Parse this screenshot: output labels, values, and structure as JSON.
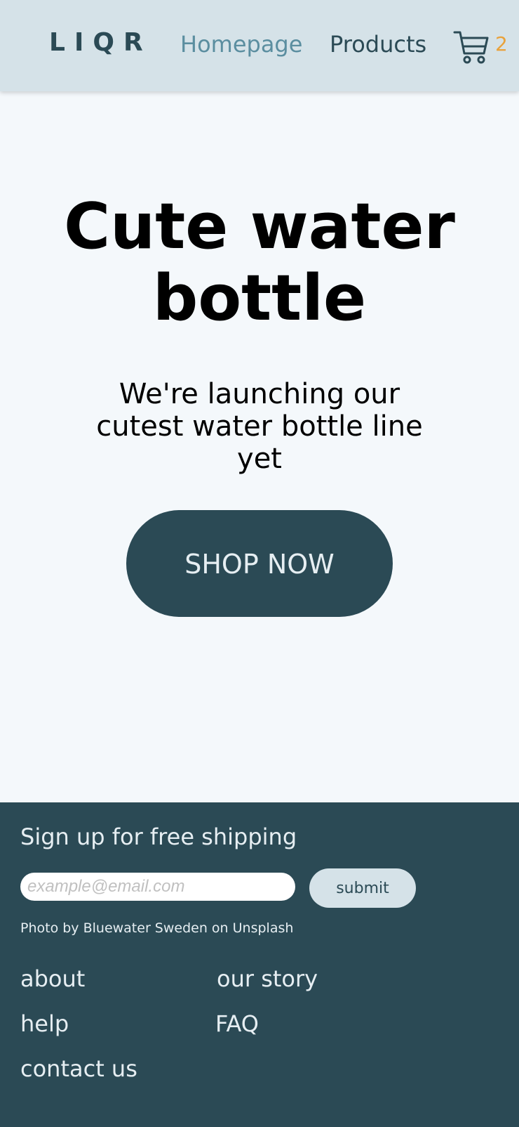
{
  "header": {
    "logo": "LIQR",
    "nav": {
      "homepage": "Homepage",
      "products": "Products"
    },
    "cart_icon": "shopping-cart-icon",
    "cart_count": "2"
  },
  "hero": {
    "title": "Cute water bottle",
    "subtitle": "We're launching our cutest water bottle line yet",
    "cta_label": "SHOP NOW"
  },
  "footer": {
    "signup_heading": "Sign up for free shipping",
    "email_placeholder": "example@email.com",
    "submit_label": "submit",
    "photo_credit": "Photo by Bluewater Sweden on Unsplash",
    "links": {
      "about": "about",
      "our_story": "our story",
      "help": "help",
      "faq": "FAQ",
      "contact_us": "contact us"
    }
  },
  "colors": {
    "header_bg": "#d5e2e8",
    "page_bg": "#f4f8fb",
    "primary_dark": "#2b4a55",
    "nav_active": "#5b8ea0",
    "cart_badge": "#e9a23b"
  }
}
